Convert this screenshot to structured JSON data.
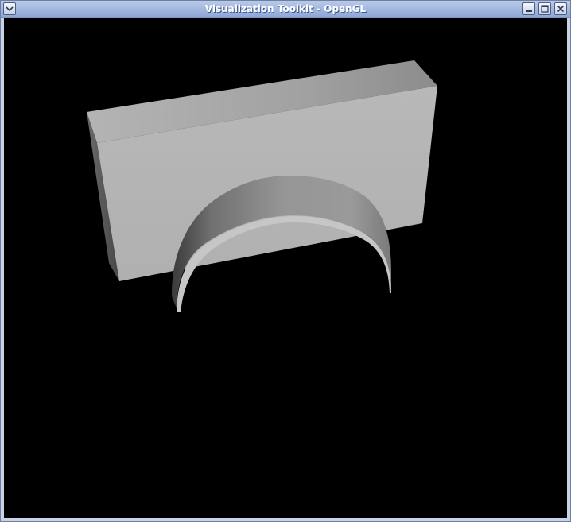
{
  "window": {
    "title": "Visualization Toolkit - OpenGL",
    "controls": {
      "menu_icon": "chevron-down-icon",
      "minimize_icon": "minimize-icon",
      "maximize_icon": "maximize-icon",
      "close_icon": "close-icon"
    }
  },
  "scene": {
    "background_color": "#000000",
    "objects": [
      "box",
      "half-cylinder-arch"
    ]
  }
}
